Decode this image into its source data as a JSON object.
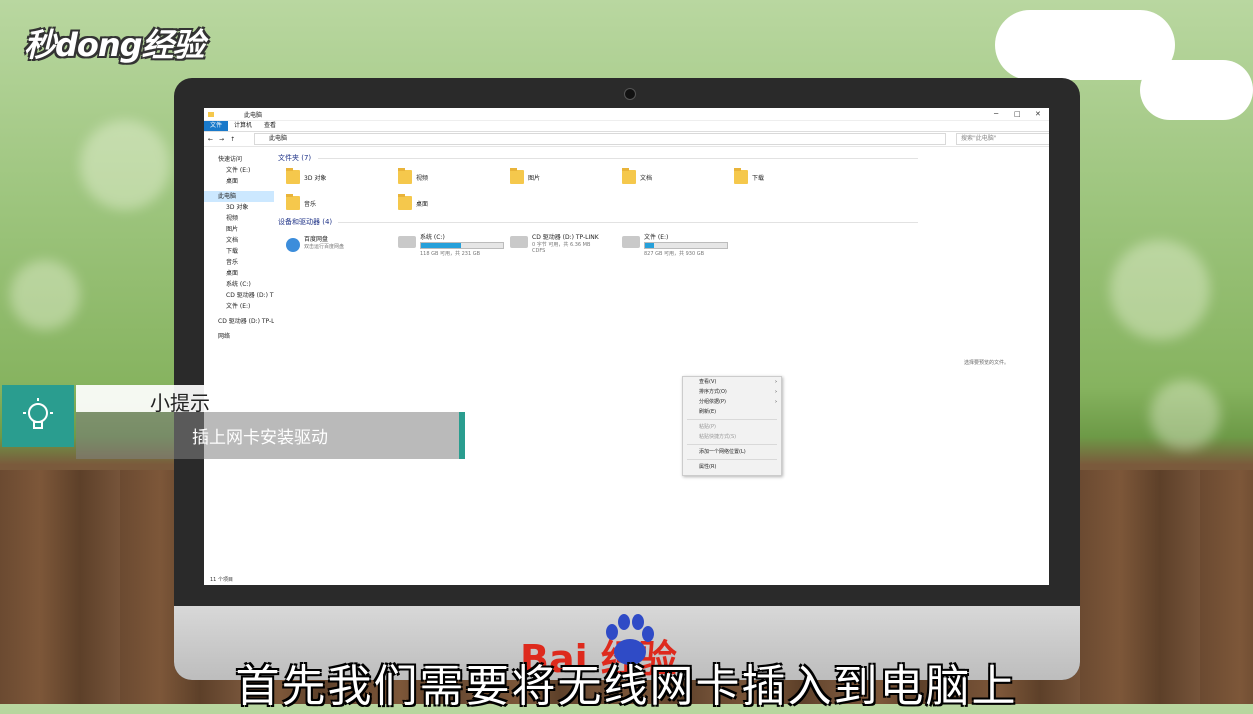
{
  "watermark": {
    "logo_text": "秒dong经验"
  },
  "window": {
    "title": "此电脑",
    "tabs": [
      "文件",
      "计算机",
      "查看"
    ],
    "address_path": "此电脑",
    "search_placeholder": "搜索\"此电脑\"",
    "status_text": "11 个项目",
    "detail_hint": "选择要预览的文件。"
  },
  "sidebar": {
    "items": [
      {
        "label": "快速访问"
      },
      {
        "label": "文件 (E:)"
      },
      {
        "label": "桌面"
      },
      {
        "label": "此电脑"
      },
      {
        "label": "3D 对象"
      },
      {
        "label": "视频"
      },
      {
        "label": "图片"
      },
      {
        "label": "文档"
      },
      {
        "label": "下载"
      },
      {
        "label": "音乐"
      },
      {
        "label": "桌面"
      },
      {
        "label": "系统 (C:)"
      },
      {
        "label": "CD 驱动器 (D:) TP-"
      },
      {
        "label": "文件 (E:)"
      },
      {
        "label": "CD 驱动器 (D:) TP-LI"
      },
      {
        "label": "网络"
      }
    ]
  },
  "folders_group": {
    "header": "文件夹 (7)",
    "items": [
      "3D 对象",
      "视频",
      "图片",
      "文档",
      "下载",
      "音乐",
      "桌面"
    ]
  },
  "devices_group": {
    "header": "设备和驱动器 (4)",
    "items": [
      {
        "name": "百度网盘",
        "sub": "双击运行百度网盘"
      },
      {
        "name": "系统 (C:)",
        "sub": "118 GB 可用，共 231 GB",
        "fill": 0.49
      },
      {
        "name": "CD 驱动器 (D:) TP-LINK",
        "sub": "0 字节 可用，共 6.36 MB",
        "sub2": "CDFS"
      },
      {
        "name": "文件 (E:)",
        "sub": "827 GB 可用，共 930 GB",
        "fill": 0.11
      }
    ]
  },
  "context_menu": {
    "items": [
      {
        "label": "查看(V)"
      },
      {
        "label": "排序方式(O)"
      },
      {
        "label": "分组依据(P)"
      },
      {
        "label": "刷新(E)"
      },
      {
        "label": "粘贴(P)"
      },
      {
        "label": "粘贴快捷方式(S)"
      },
      {
        "label": "添加一个网络位置(L)"
      },
      {
        "label": "属性(R)"
      }
    ]
  },
  "tip": {
    "title": "小提示",
    "text": "插上网卡安装驱动"
  },
  "brand": {
    "text": "Bai  经验"
  },
  "subtitle": "首先我们需要将无线网卡插入到电脑上",
  "colors": {
    "teal": "#2a9d8f",
    "explorer_blue": "#1979ca",
    "brand_red": "#de2a1d"
  }
}
